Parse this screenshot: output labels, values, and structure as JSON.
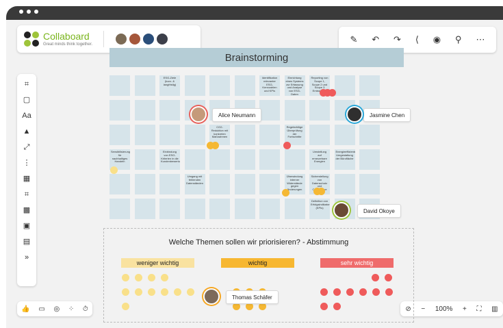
{
  "app": {
    "name": "Collaboard",
    "tagline": "Great minds think together."
  },
  "toolbar": {
    "icons": [
      "magic-wand-icon",
      "undo-icon",
      "redo-icon",
      "share-icon",
      "timer-cursor-icon",
      "search-icon",
      "more-icon"
    ],
    "glyphs": [
      "✎",
      "↶",
      "↷",
      "⟨",
      "◉",
      "⚲",
      "⋯"
    ]
  },
  "left_tools": {
    "glyphs": [
      "⌗",
      "▢",
      "Aa",
      "▲",
      "⤢",
      "⋮",
      "▦",
      "⌗",
      "▩",
      "▣",
      "▤",
      "»"
    ],
    "names": [
      "frame-tool-icon",
      "sticky-note-tool-icon",
      "text-tool-icon",
      "shapes-tool-icon",
      "connector-tool-icon",
      "list-tool-icon",
      "table-tool-icon",
      "crop-tool-icon",
      "image-tool-icon",
      "template-tool-icon",
      "comment-tool-icon",
      "expand-icon"
    ]
  },
  "bottom_left": {
    "glyphs": [
      "👍",
      "▭",
      "◎",
      "⁘",
      "⏱"
    ],
    "names": [
      "like-icon",
      "present-icon",
      "focus-icon",
      "cursor-icon",
      "timer-icon"
    ]
  },
  "zoom": {
    "level": "100%",
    "minus": "−",
    "plus": "+"
  },
  "board_title": "Brainstorming",
  "sticky_texts": {
    "c1": "ESG-Ziele (kurz- & langfristig)",
    "c2": "Identifikation relevanter ESG-Kennzahlen und KPIs",
    "c3": "Einrichtung eines Systems zur Erfassung und Analyse von ESG-Daten",
    "c4": "Reporting von Scope 1, Scope 2 und Scope 3 Emissionen",
    "c5": "CO2-Reduktion mit konkreten Maßnahmen",
    "c6": "Regelmäßige Überprüfung der Fortschritte",
    "c7": "Sensibilisierung für nachhaltiges Handeln",
    "c8": "Einbindung von ESG-Kriterien in die Kundenbewertung",
    "c9": "Umstellung auf erneuerbare Energien",
    "c10": "Energieeffiziente Umgestaltung der Bürofläche",
    "c11": "Umgang mit fehlenden Datenständen",
    "c12": "Überwindung interner Widerstände gegen Änderungen",
    "c13": "Sicherstellung von Datenschutz und Compliance",
    "c14": "Definition von Erfolgsindikatoren (KPIs)"
  },
  "participants": [
    {
      "name": "Alice Neumann",
      "color": "#e8605a"
    },
    {
      "name": "Jasmine Chen",
      "color": "#2aa7d8"
    },
    {
      "name": "David Okoye",
      "color": "#9ec43a"
    },
    {
      "name": "Thomas Schäfer",
      "color": "#f5a623"
    }
  ],
  "vote": {
    "question": "Welche Themen sollen wir priorisieren? - Abstimmung",
    "categories": [
      {
        "label": "weniger wichtig",
        "bg": "#f9e2a0",
        "votes": 11
      },
      {
        "label": "wichtig",
        "bg": "#f7b731",
        "votes": 7
      },
      {
        "label": "sehr wichtig",
        "bg": "#ef6b6b",
        "votes": 10
      }
    ]
  },
  "colors": {
    "sticky": "#d6e4ea",
    "title_bar": "#b5cdd6",
    "vote_yellow": "#f9e08a",
    "vote_orange": "#f5b834",
    "vote_red": "#ef5b5b"
  }
}
